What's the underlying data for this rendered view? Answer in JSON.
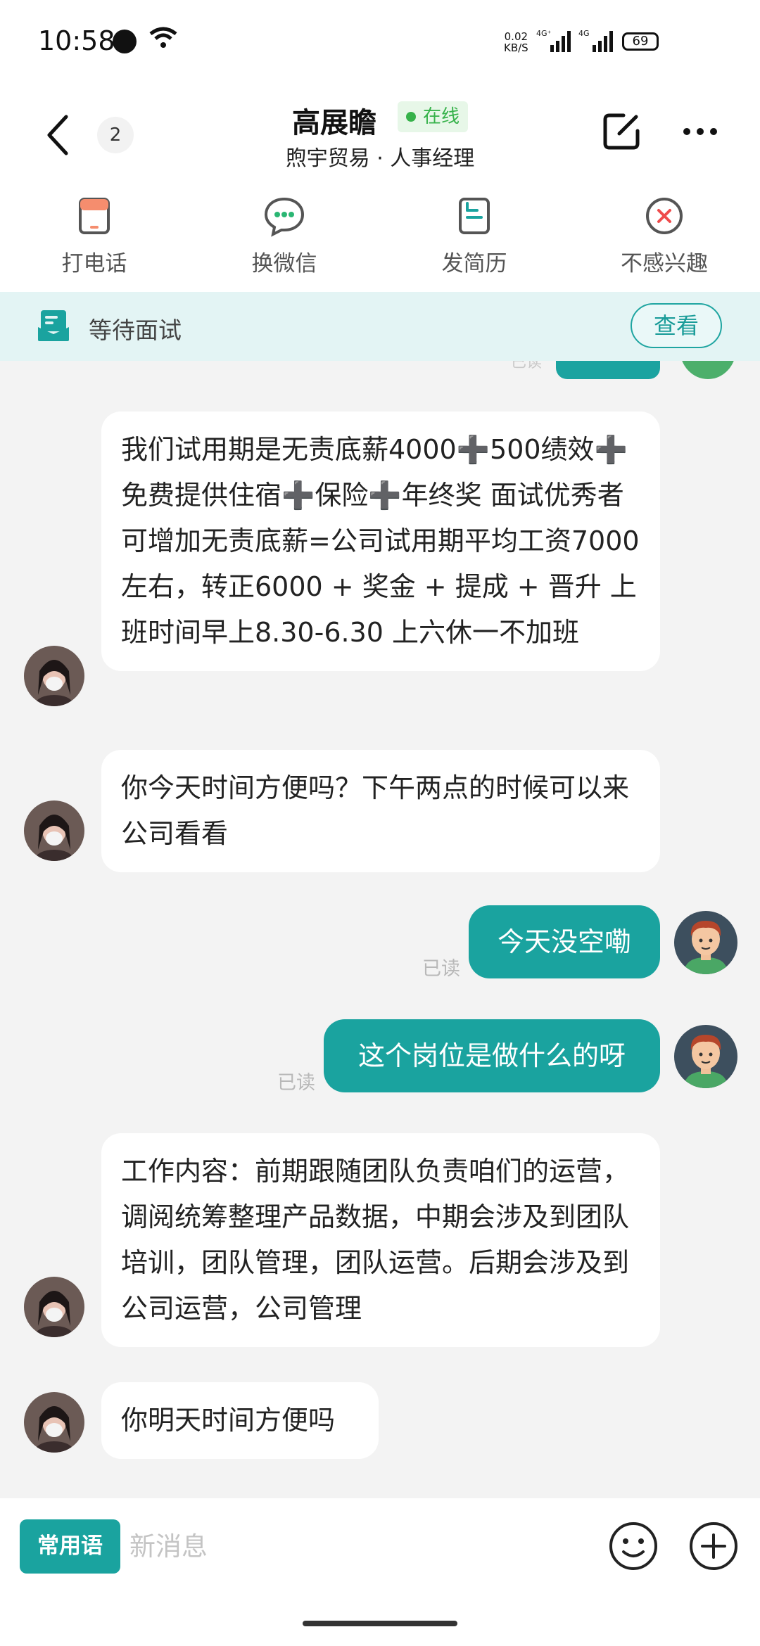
{
  "status_bar": {
    "time": "10:58",
    "speed_value": "0.02",
    "speed_unit": "KB/S",
    "sim1_label": "4G⁺",
    "sim2_label": "4G",
    "battery": "69"
  },
  "header": {
    "unread_count": "2",
    "contact_name": "高展瞻",
    "status": "在线",
    "subtitle": "煦宇贸易 · 人事经理"
  },
  "actions": [
    {
      "label": "打电话",
      "icon": "phone-icon"
    },
    {
      "label": "换微信",
      "icon": "wechat-icon"
    },
    {
      "label": "发简历",
      "icon": "resume-icon"
    },
    {
      "label": "不感兴趣",
      "icon": "not-interested-icon"
    }
  ],
  "banner": {
    "text": "等待面试",
    "button": "查看"
  },
  "messages": [
    {
      "from": "them",
      "text": "我们试用期是无责底薪4000➕500绩效➕免费提供住宿➕保险➕年终奖 面试优秀者可增加无责底薪=公司试用期平均工资7000左右，转正6000 + 奖金 + 提成 + 晋升 上班时间早上8.30-6.30 上六休一不加班"
    },
    {
      "from": "them",
      "text": "你今天时间方便吗？下午两点的时候可以来公司看看"
    },
    {
      "from": "me",
      "text": "今天没空嘞",
      "status": "已读"
    },
    {
      "from": "me",
      "text": "这个岗位是做什么的呀",
      "status": "已读"
    },
    {
      "from": "them",
      "text": "工作内容：前期跟随团队负责咱们的运营，调阅统筹整理产品数据，中期会涉及到团队培训，团队管理，团队运营。后期会涉及到公司运营，公司管理"
    },
    {
      "from": "them",
      "text": "你明天时间方便吗"
    }
  ],
  "peek_read": "已读",
  "input": {
    "phrases_button": "常用语",
    "placeholder": "新消息"
  },
  "colors": {
    "accent": "#1aa39f",
    "online": "#36b24a",
    "banner_bg": "#e3f4f4",
    "chat_bg": "#f3f3f3"
  }
}
